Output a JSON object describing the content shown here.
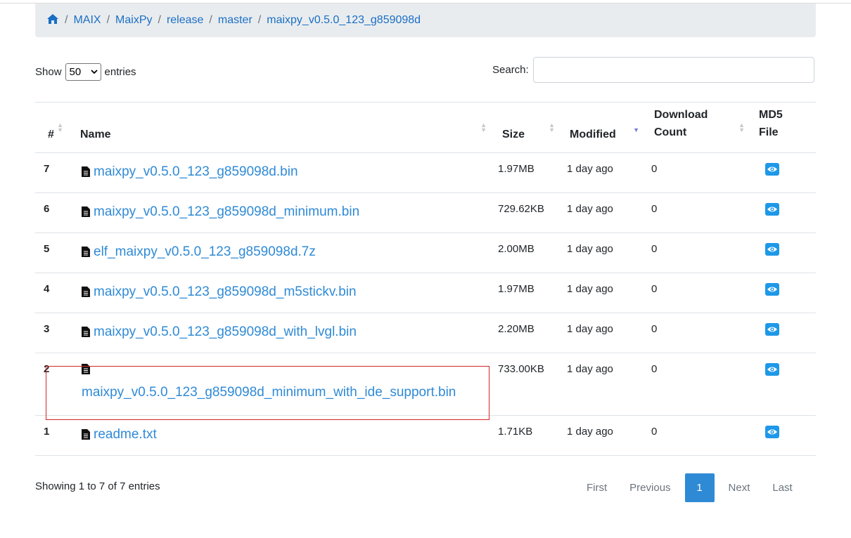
{
  "breadcrumb": {
    "items": [
      "MAIX",
      "MaixPy",
      "release",
      "master",
      "maixpy_v0.5.0_123_g859098d"
    ],
    "separator": "/"
  },
  "length": {
    "show_label": "Show",
    "value": "50",
    "entries_label": "entries"
  },
  "search": {
    "label": "Search:",
    "value": ""
  },
  "columns": {
    "index": "#",
    "name": "Name",
    "size": "Size",
    "modified": "Modified",
    "download_1": "Download",
    "download_2": "Count",
    "md5_1": "MD5",
    "md5_2": "File"
  },
  "rows": [
    {
      "index": "7",
      "name": "maixpy_v0.5.0_123_g859098d.bin",
      "size": "1.97MB",
      "modified": "1 day ago",
      "count": "0"
    },
    {
      "index": "6",
      "name": "maixpy_v0.5.0_123_g859098d_minimum.bin",
      "size": "729.62KB",
      "modified": "1 day ago",
      "count": "0"
    },
    {
      "index": "5",
      "name": "elf_maixpy_v0.5.0_123_g859098d.7z",
      "size": "2.00MB",
      "modified": "1 day ago",
      "count": "0"
    },
    {
      "index": "4",
      "name": "maixpy_v0.5.0_123_g859098d_m5stickv.bin",
      "size": "1.97MB",
      "modified": "1 day ago",
      "count": "0"
    },
    {
      "index": "3",
      "name": "maixpy_v0.5.0_123_g859098d_with_lvgl.bin",
      "size": "2.20MB",
      "modified": "1 day ago",
      "count": "0"
    },
    {
      "index": "2",
      "name": "maixpy_v0.5.0_123_g859098d_minimum_with_ide_support.bin",
      "size": "733.00KB",
      "modified": "1 day ago",
      "count": "0"
    },
    {
      "index": "1",
      "name": "readme.txt",
      "size": "1.71KB",
      "modified": "1 day ago",
      "count": "0"
    }
  ],
  "info": "Showing 1 to 7 of 7 entries",
  "pagination": {
    "first": "First",
    "previous": "Previous",
    "current": "1",
    "next": "Next",
    "last": "Last"
  },
  "colors": {
    "link": "#2f8ad6",
    "eye_button": "#1e98e8",
    "highlight": "#d32525"
  }
}
